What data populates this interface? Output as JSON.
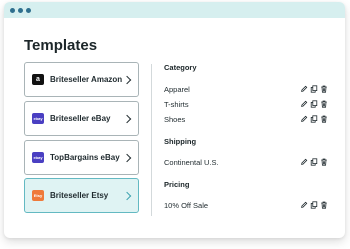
{
  "window": {
    "controls": [
      "dot",
      "dot",
      "dot"
    ]
  },
  "page": {
    "title": "Templates"
  },
  "templates": [
    {
      "label": "Briteseller Amazon",
      "logo": "amazon-logo",
      "logo_text": "a",
      "selected": false
    },
    {
      "label": "Briteseller eBay",
      "logo": "ebay-logo",
      "logo_text": "ebay",
      "selected": false
    },
    {
      "label": "TopBargains eBay",
      "logo": "ebay-logo",
      "logo_text": "ebay",
      "selected": false
    },
    {
      "label": "Briteseller Etsy",
      "logo": "etsy-logo",
      "logo_text": "Etsy",
      "selected": true
    }
  ],
  "sections": [
    {
      "title": "Category",
      "items": [
        "Apparel",
        "T-shirts",
        "Shoes"
      ]
    },
    {
      "title": "Shipping",
      "items": [
        "Continental U.S."
      ]
    },
    {
      "title": "Pricing",
      "items": [
        "10% Off Sale"
      ]
    }
  ],
  "row_actions": [
    "edit-icon",
    "copy-icon",
    "delete-icon"
  ],
  "colors": {
    "titlebar": "#d6efef",
    "window_dots": "#2e6f8e",
    "selected_card_bg": "#dff3f3",
    "selected_card_border": "#63b9c2",
    "ebay_logo": "#4a3fc2",
    "etsy_logo": "#ef7a3a"
  }
}
